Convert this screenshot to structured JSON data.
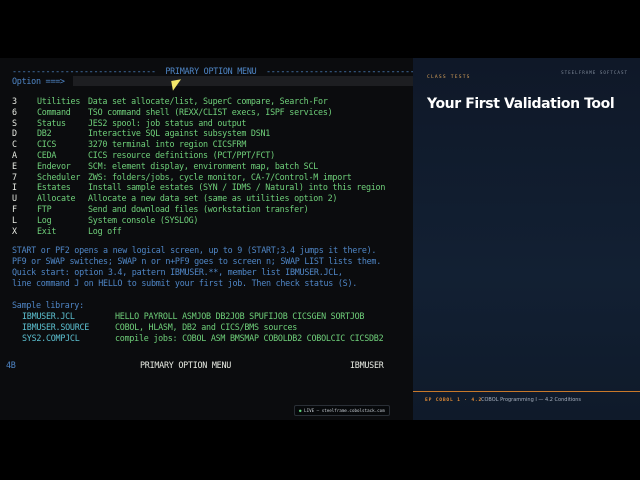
{
  "terminal": {
    "title_line": "------------------------------  PRIMARY OPTION MENU  ------------------------------------",
    "option_label": "Option ===>",
    "option_value": "",
    "menu": [
      {
        "key": "3",
        "name": "Utilities",
        "desc": "Data set allocate/list, SuperC compare, Search-For"
      },
      {
        "key": "6",
        "name": "Command",
        "desc": "TSO command shell (REXX/CLIST execs, ISPF services)"
      },
      {
        "key": "S",
        "name": "Status",
        "desc": "JES2 spool: job status and output"
      },
      {
        "key": "D",
        "name": "DB2",
        "desc": "Interactive SQL against subsystem DSN1"
      },
      {
        "key": "C",
        "name": "CICS",
        "desc": "3270 terminal into region CICSFRM"
      },
      {
        "key": "A",
        "name": "CEDA",
        "desc": "CICS resource definitions (PCT/PPT/FCT)"
      },
      {
        "key": "E",
        "name": "Endevor",
        "desc": "SCM: element display, environment map, batch SCL"
      },
      {
        "key": "7",
        "name": "Scheduler",
        "desc": "ZWS: folders/jobs, cycle monitor, CA-7/Control-M import"
      },
      {
        "key": "I",
        "name": "Estates",
        "desc": "Install sample estates (SYN / IDMS / Natural) into this region"
      },
      {
        "key": "U",
        "name": "Allocate",
        "desc": "Allocate a new data set (same as utilities option 2)"
      },
      {
        "key": "F",
        "name": "FTP",
        "desc": "Send and download files (workstation transfer)"
      },
      {
        "key": "L",
        "name": "Log",
        "desc": "System console (SYSLOG)"
      },
      {
        "key": "X",
        "name": "Exit",
        "desc": "Log off"
      }
    ],
    "help_lines": [
      "START or PF2 opens a new logical screen, up to 9 (START;3.4 jumps it there).",
      "PF9 or SWAP switches; SWAP n or n+PF9 goes to screen n; SWAP LIST lists them.",
      "Quick start: option 3.4, pattern IBMUSER.**, member list IBMUSER.JCL,",
      "line command J on HELLO to submit your first job. Then check status (S)."
    ],
    "library_heading": "Sample library:",
    "library": [
      {
        "ds": "IBMUSER.JCL",
        "desc": "HELLO PAYROLL ASMJOB DB2JOB SPUFIJOB CICSGEN SORTJOB"
      },
      {
        "ds": "IBMUSER.SOURCE",
        "desc": "COBOL, HLASM, DB2 and CICS/BMS sources"
      },
      {
        "ds": "SYS2.COMPJCL",
        "desc": "compile jobs: COBOL ASM BMSMAP COBOLDB2 COBOLCIC CICSDB2"
      }
    ],
    "status_bar": {
      "left": "4B",
      "center": "PRIMARY OPTION MENU",
      "right": "IBMUSER"
    }
  },
  "badge": {
    "text": "LIVE — steelframe.cobolstack.com"
  },
  "panel": {
    "kicker": "CLASS TESTS",
    "brand": "STEELFRAME SOFTCAST",
    "title": "Your First Validation Tool",
    "course_code": "EP COBOL 1 · 4.2",
    "course_title": "COBOL Programming I — 4.2 Conditions"
  },
  "colors": {
    "terminal_bg": "#0b0c0e",
    "blue": "#4f86c6",
    "green": "#6fd07a",
    "white": "#e9ece4",
    "yellow": "#e7d14c",
    "accent_orange": "#e08a35",
    "panel_bg": "#101a2a"
  }
}
